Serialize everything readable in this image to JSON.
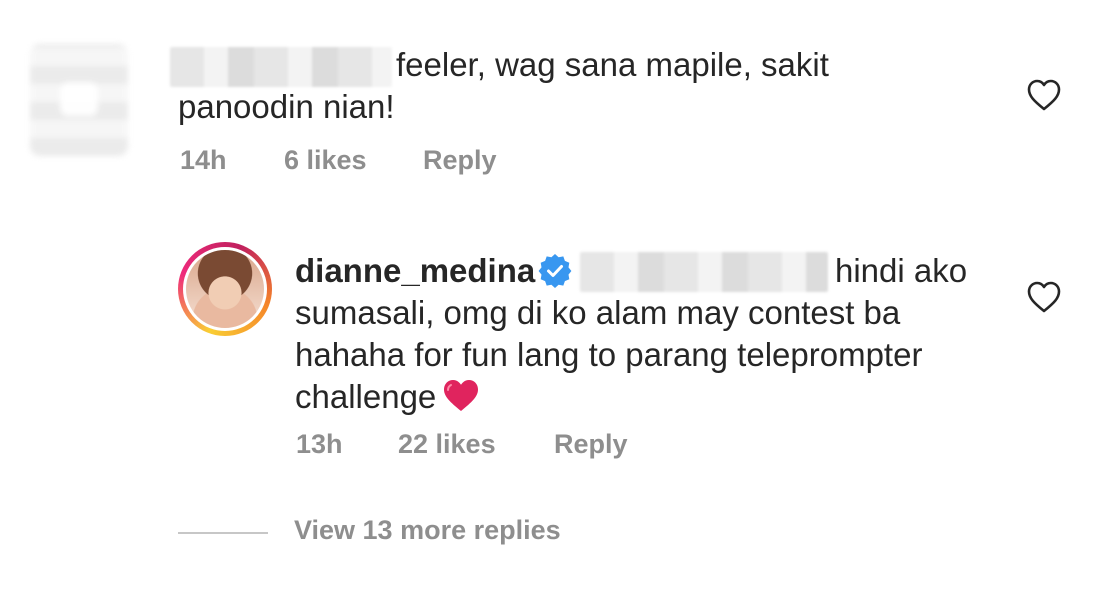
{
  "comments": [
    {
      "text": "feeler, wag sana mapile, sakit panoodin nian!",
      "time": "14h",
      "likes": "6 likes",
      "reply_label": "Reply"
    }
  ],
  "reply": {
    "username": "dianne_medina",
    "verified": true,
    "text": "hindi ako sumasali, omg di ko alam may contest ba hahaha for fun lang to parang teleprompter challenge",
    "emoji": "heart-emoji",
    "time": "13h",
    "likes": "22 likes",
    "reply_label": "Reply"
  },
  "view_replies": "View 13 more replies",
  "colors": {
    "text": "#262626",
    "meta": "#8e8e8e",
    "verified": "#3897f0",
    "heart_emoji": "#e0245e"
  }
}
